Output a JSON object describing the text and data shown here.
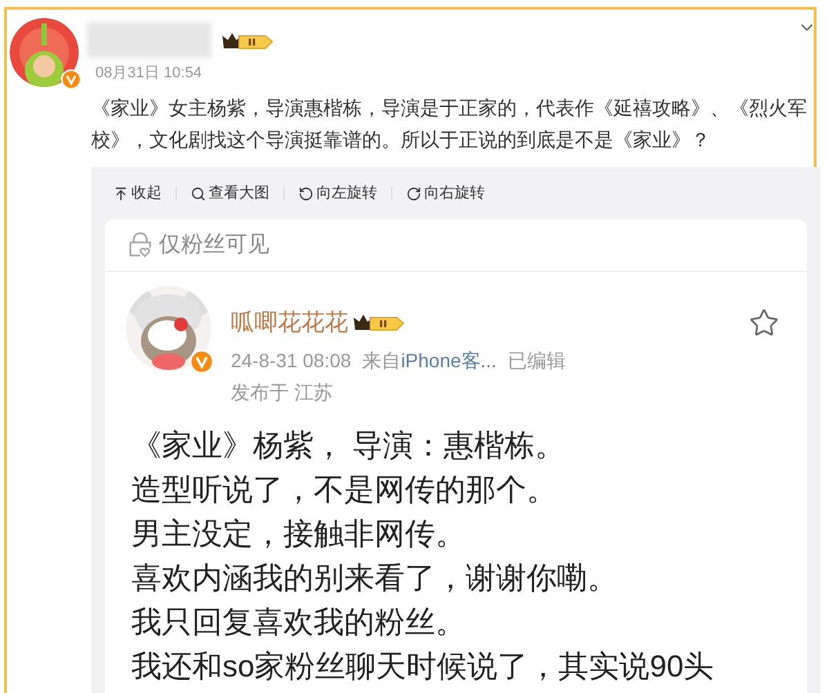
{
  "post": {
    "date": "08月31日 10:54",
    "text": "《家业》女主杨紫，导演惠楷栋，导演是于正家的，代表作《延禧攻略》、《烈火军校》，文化剧找这个导演挺靠谱的。所以于正说的到底是不是《家业》？"
  },
  "image_toolbar": [
    {
      "kind": "collapse",
      "label": "收起"
    },
    {
      "kind": "zoom",
      "label": "查看大图"
    },
    {
      "kind": "rotate_left",
      "label": "向左旋转"
    },
    {
      "kind": "rotate_right",
      "label": "向右旋转"
    }
  ],
  "screenshot": {
    "visibility": "仅粉丝可见",
    "author": "呱唧花花花",
    "time": "24-8-31 08:08",
    "source_prefix": "来自",
    "source": "iPhone客...",
    "edited": "已编辑",
    "location": "发布于 江苏",
    "lines": [
      "《家业》杨紫， 导演：惠楷栋。",
      "造型听说了，不是网传的那个。",
      "男主没定，接触非网传。",
      "喜欢内涵我的别来看了，谢谢你嘞。",
      "我只回复喜欢我的粉丝。",
      "我还和so家粉丝聊天时候说了，其实说90头"
    ]
  }
}
